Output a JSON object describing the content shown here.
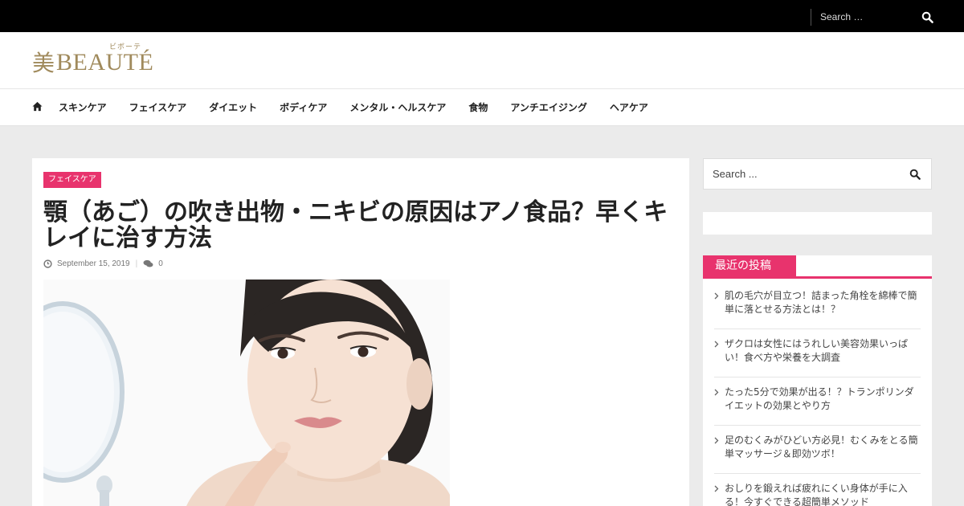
{
  "topbar": {
    "search_placeholder": "Search …"
  },
  "header": {
    "logo_kanji": "美",
    "logo_word": "BEAUTÉ",
    "logo_ruby": "ビボーテ"
  },
  "nav": {
    "items": [
      {
        "label": "スキンケア"
      },
      {
        "label": "フェイスケア"
      },
      {
        "label": "ダイエット"
      },
      {
        "label": "ボディケア"
      },
      {
        "label": "メンタル・ヘルスケア"
      },
      {
        "label": "食物"
      },
      {
        "label": "アンチエイジング"
      },
      {
        "label": "ヘアケア"
      }
    ]
  },
  "post": {
    "category": "フェイスケア",
    "title": "顎（あご）の吹き出物・ニキビの原因はアノ食品？早くキレイに治す方法",
    "date": "September 15, 2019",
    "comments": "0"
  },
  "sidebar": {
    "search_placeholder": "Search ...",
    "recent_title": "最近の投稿",
    "recent_posts": [
      {
        "title": "肌の毛穴が目立つ！詰まった角栓を綿棒で簡単に落とせる方法とは！？"
      },
      {
        "title": "ザクロは女性にはうれしい美容効果いっぱい！食べ方や栄養を大調査"
      },
      {
        "title": "たった5分で効果が出る！？トランポリンダイエットの効果とやり方"
      },
      {
        "title": "足のむくみがひどい方必見！むくみをとる簡単マッサージ＆即効ツボ！"
      },
      {
        "title": "おしりを鍛えれば疲れにくい身体が手に入る！今すぐできる超簡単メソッド"
      }
    ]
  },
  "colors": {
    "accent": "#e8336d",
    "logo": "#a08a5c",
    "topbar": "#000000",
    "page_bg": "#ebebeb"
  }
}
